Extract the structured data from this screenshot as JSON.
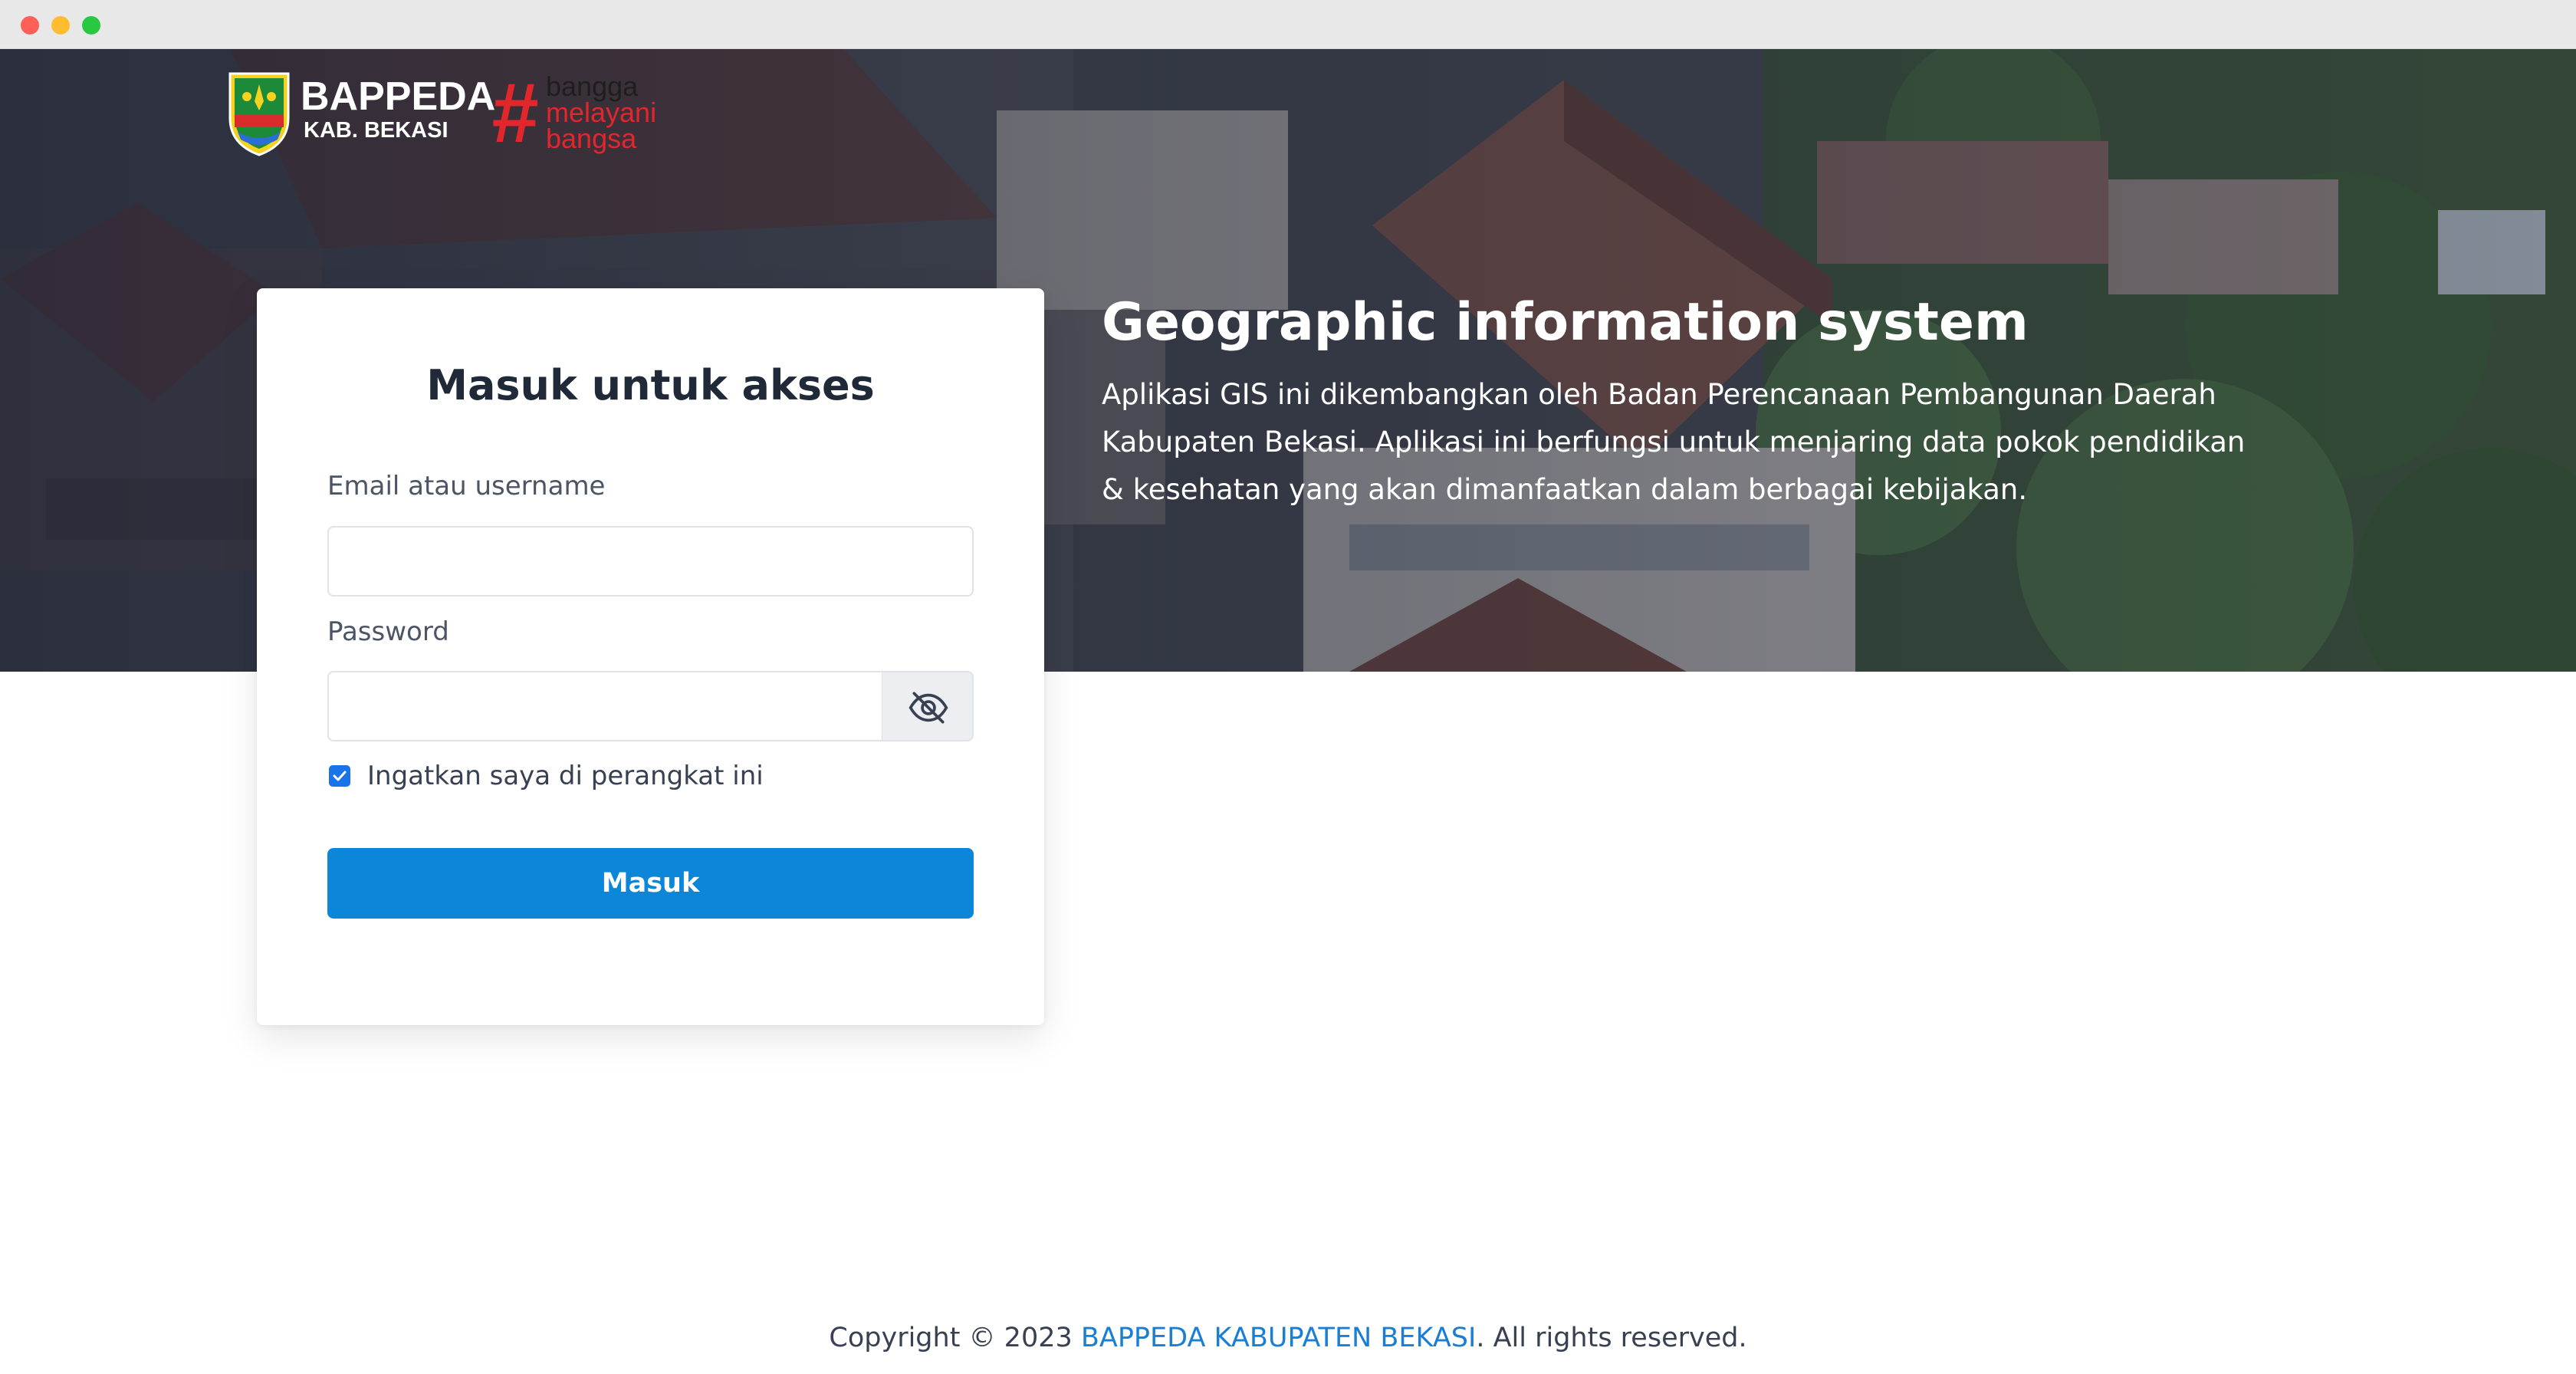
{
  "header": {
    "logo_title": "BAPPEDA",
    "logo_subtitle": "KAB. BEKASI",
    "bangga_hash": "#",
    "bangga_words": [
      "bangga",
      "melayani",
      "bangsa"
    ]
  },
  "hero": {
    "title": "Geographic information system",
    "description": "Aplikasi GIS ini dikembangkan oleh Badan Perencanaan Pembangunan Daerah Kabupaten Bekasi. Aplikasi ini berfungsi untuk menjaring data pokok pendidikan & kesehatan yang akan dimanfaatkan dalam berbagai kebijakan."
  },
  "login": {
    "title": "Masuk untuk akses",
    "email_label": "Email atau username",
    "email_value": "",
    "password_label": "Password",
    "password_value": "",
    "toggle_icon": "eye-off-icon",
    "remember_label": "Ingatkan saya di perangkat ini",
    "remember_checked": true,
    "submit_label": "Masuk"
  },
  "footer": {
    "prefix": "Copyright © 2023 ",
    "link_text": "BAPPEDA KABUPATEN BEKASI",
    "suffix": ". All rights reserved."
  },
  "colors": {
    "primary": "#0b86d9",
    "link": "#1a7fd4",
    "brand_red": "#e1262c"
  }
}
